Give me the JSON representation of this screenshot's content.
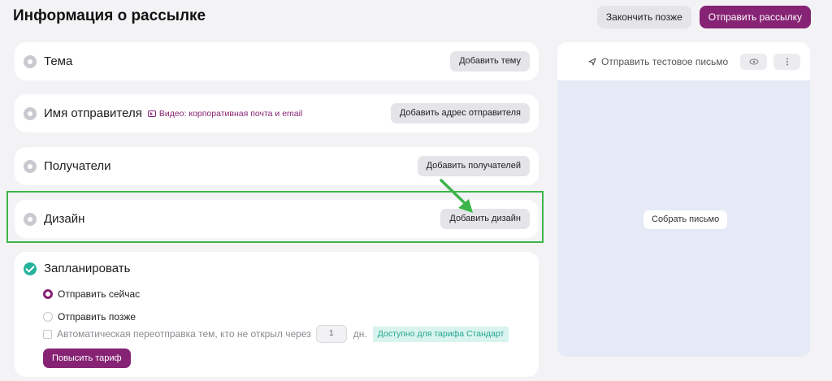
{
  "header": {
    "title": "Информация о рассылке",
    "finish_later": "Закончить позже",
    "send_campaign": "Отправить рассылку"
  },
  "sections": {
    "subject": {
      "title": "Тема",
      "button": "Добавить тему"
    },
    "sender": {
      "title": "Имя отправителя",
      "video_link": "Видео: корпоративная почта и email",
      "button": "Добавить адрес отправителя"
    },
    "recipients": {
      "title": "Получатели",
      "button": "Добавить получателей"
    },
    "design": {
      "title": "Дизайн",
      "button": "Добавить дизайн"
    }
  },
  "schedule": {
    "title": "Запланировать",
    "send_now": "Отправить сейчас",
    "send_now_selected": true,
    "send_later": "Отправить позже",
    "resend_label": "Автоматическая переотправка тем, кто не открыл через",
    "resend_days": "1",
    "resend_unit": "дн.",
    "plan_badge": "Доступно для тарифа Стандарт",
    "upgrade_button": "Повысить тариф"
  },
  "preview": {
    "test_send": "Отправить тестовое письмо",
    "compose": "Собрать письмо",
    "icons": [
      "send-icon",
      "eye-icon",
      "more-vertical-icon"
    ]
  },
  "colors": {
    "accent": "#862374",
    "success": "#25b39c",
    "highlight": "#3db54a"
  }
}
